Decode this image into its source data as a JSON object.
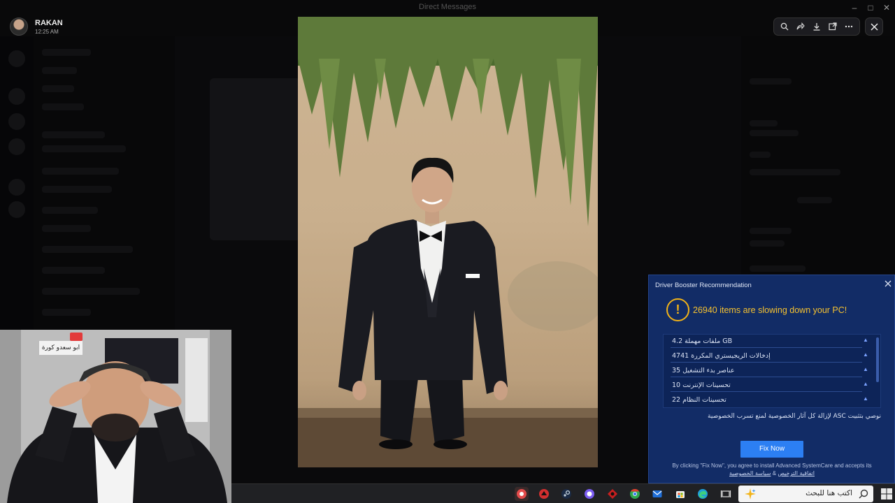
{
  "window": {
    "title": "Direct Messages"
  },
  "viewer": {
    "user_name": "RAKAN",
    "time": "12:25 AM"
  },
  "webcam": {
    "sign_text": "ابو سعدو كورة"
  },
  "popup": {
    "title": "Driver Booster Recommendation",
    "headline": "26940 items are slowing down your PC!",
    "items": [
      {
        "label": "ملفات مهملة 4.2 GB"
      },
      {
        "label": "إدخالات الريجيستري المكررة 4741"
      },
      {
        "label": "عناصر بدء التشغيل 35"
      },
      {
        "label": "تحسينات الإنترنت 10"
      },
      {
        "label": "تحسينات النظام 22"
      }
    ],
    "privacy_text": "نوصي بتثبيت ASC لإزالة كل آثار الخصوصية لمنع تسرب الخصوصية",
    "fix_button": "Fix Now",
    "disclaimer": "By clicking \"Fix Now\", you agree to install Advanced SystemCare and accepts its",
    "link_license": "اتفاقية الترخيص",
    "link_and": "&",
    "link_privacy": "سياسة الخصوصية",
    "accent_color": "#f6c230",
    "button_color": "#2c7ff3"
  },
  "taskbar": {
    "search_placeholder": "اكتب هنا للبحث",
    "icons": [
      "chrome-alt-icon",
      "discord-icon",
      "steam-icon",
      "arc-icon",
      "game-icon",
      "chrome-icon",
      "mail-icon",
      "store-icon",
      "edge-icon",
      "task-view-icon"
    ]
  }
}
